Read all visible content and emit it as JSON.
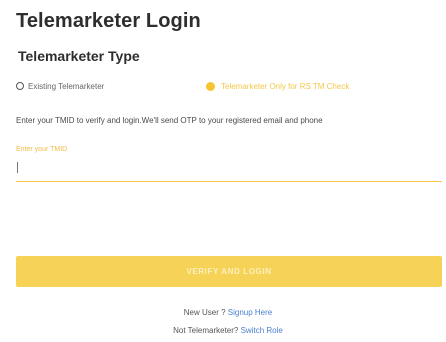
{
  "page": {
    "title": "Telemarketer Login",
    "subtitle": "Telemarketer Type"
  },
  "telemarketer_type": {
    "options": [
      {
        "label": "Existing Telemarketer",
        "checked": false
      },
      {
        "label": "Telemarketer Only for RS TM Check",
        "checked": true
      }
    ]
  },
  "instruction": "Enter your TMID to verify and login.We'll send OTP to your registered email and phone",
  "tmid_field": {
    "label": "Enter your TMID",
    "value": "",
    "placeholder": ""
  },
  "submit": {
    "label": "VERIFY AND LOGIN"
  },
  "footer": {
    "new_user_prefix": "New User ?",
    "signup_link": "Signup Here",
    "not_tm_prefix": "Not Telemarketer?",
    "switch_role_link": "Switch Role"
  },
  "colors": {
    "accent": "#f6d357",
    "link": "#4a7fcf",
    "text": "#333333"
  }
}
